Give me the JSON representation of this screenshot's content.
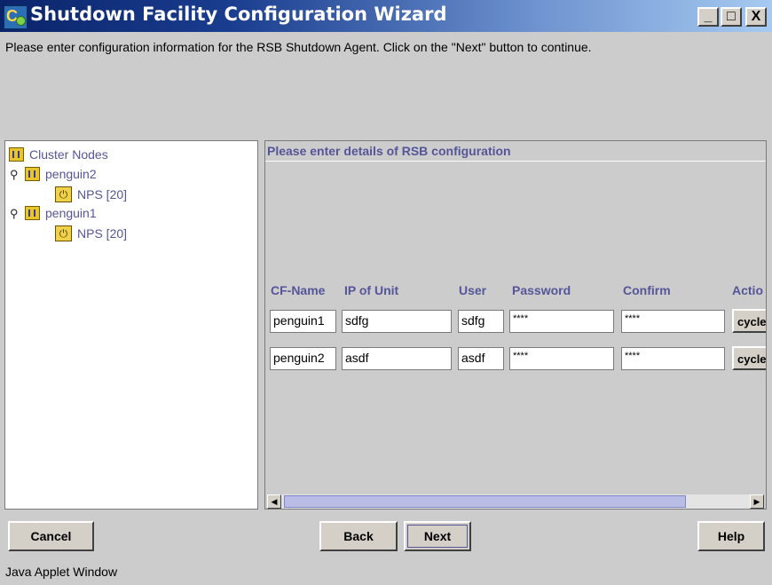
{
  "window": {
    "title": "Shutdown Facility Configuration Wizard",
    "minimize": "_",
    "maximize": "□",
    "close": "X"
  },
  "instruction": "Please enter configuration information for the RSB Shutdown Agent. Click on the \"Next\" button to continue.",
  "tree": {
    "root": "Cluster Nodes",
    "nodes": [
      {
        "name": "penguin2",
        "child": "NPS [20]"
      },
      {
        "name": "penguin1",
        "child": "NPS [20]"
      }
    ]
  },
  "panel": {
    "header": "Please enter details of RSB configuration",
    "columns": [
      "CF-Name",
      "IP of Unit",
      "User",
      "Password",
      "Confirm",
      "Actio"
    ],
    "rows": [
      {
        "cf_name": "penguin1",
        "ip": "sdfg",
        "user": "sdfg",
        "password": "****",
        "confirm": "****",
        "action": "cycle"
      },
      {
        "cf_name": "penguin2",
        "ip": "asdf",
        "user": "asdf",
        "password": "****",
        "confirm": "****",
        "action": "cycle"
      }
    ]
  },
  "buttons": {
    "cancel": "Cancel",
    "back": "Back",
    "next": "Next",
    "help": "Help"
  },
  "status": "Java Applet Window",
  "icons": {
    "app": "cluster-wizard-icon",
    "node": "server-folder-icon",
    "nps": "power-switch-icon",
    "expand": "tree-handle-icon"
  }
}
